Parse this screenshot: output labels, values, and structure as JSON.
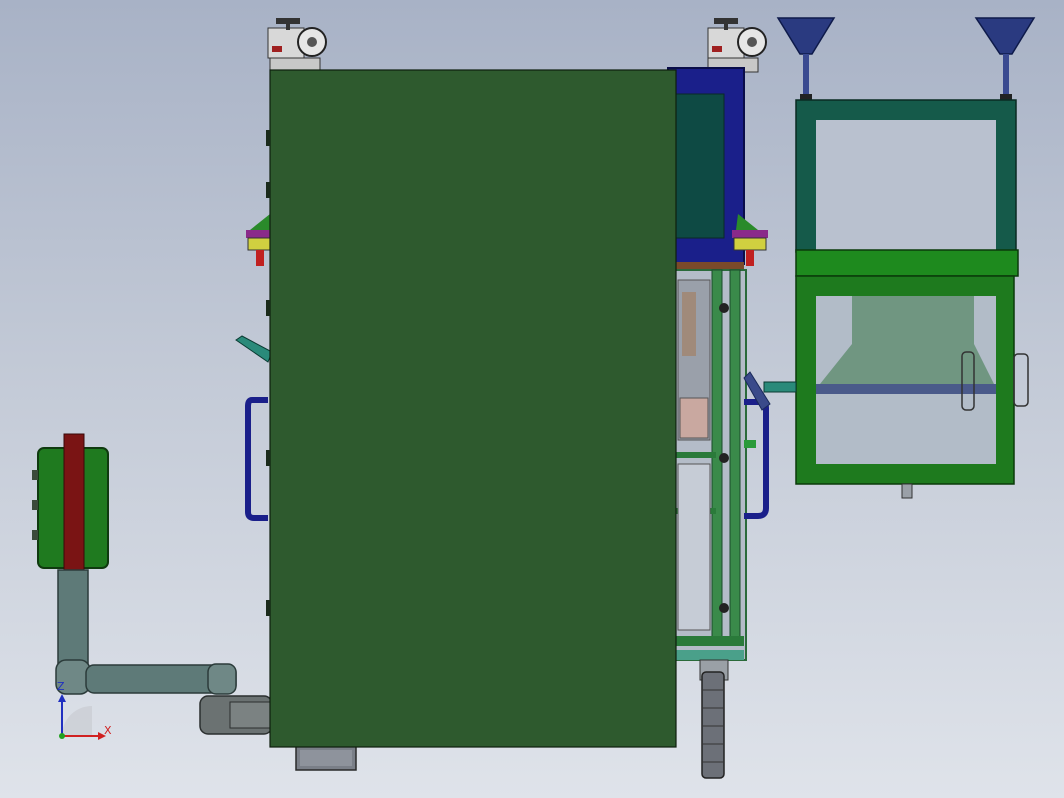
{
  "triad": {
    "x_label": "X",
    "z_label": "Z"
  },
  "colors": {
    "background_top": "#a8b2c6",
    "background_bottom": "#dfe3ea",
    "cover_panel": "#2e5a2e",
    "frame_blue": "#1a1f8a",
    "frame_green": "#1e7a2a",
    "pipe_gray": "#4f6a6a",
    "hopper_navy": "#3a4a80",
    "axis_x": "#d02020",
    "axis_y": "#20a020",
    "axis_z": "#2030c0"
  }
}
